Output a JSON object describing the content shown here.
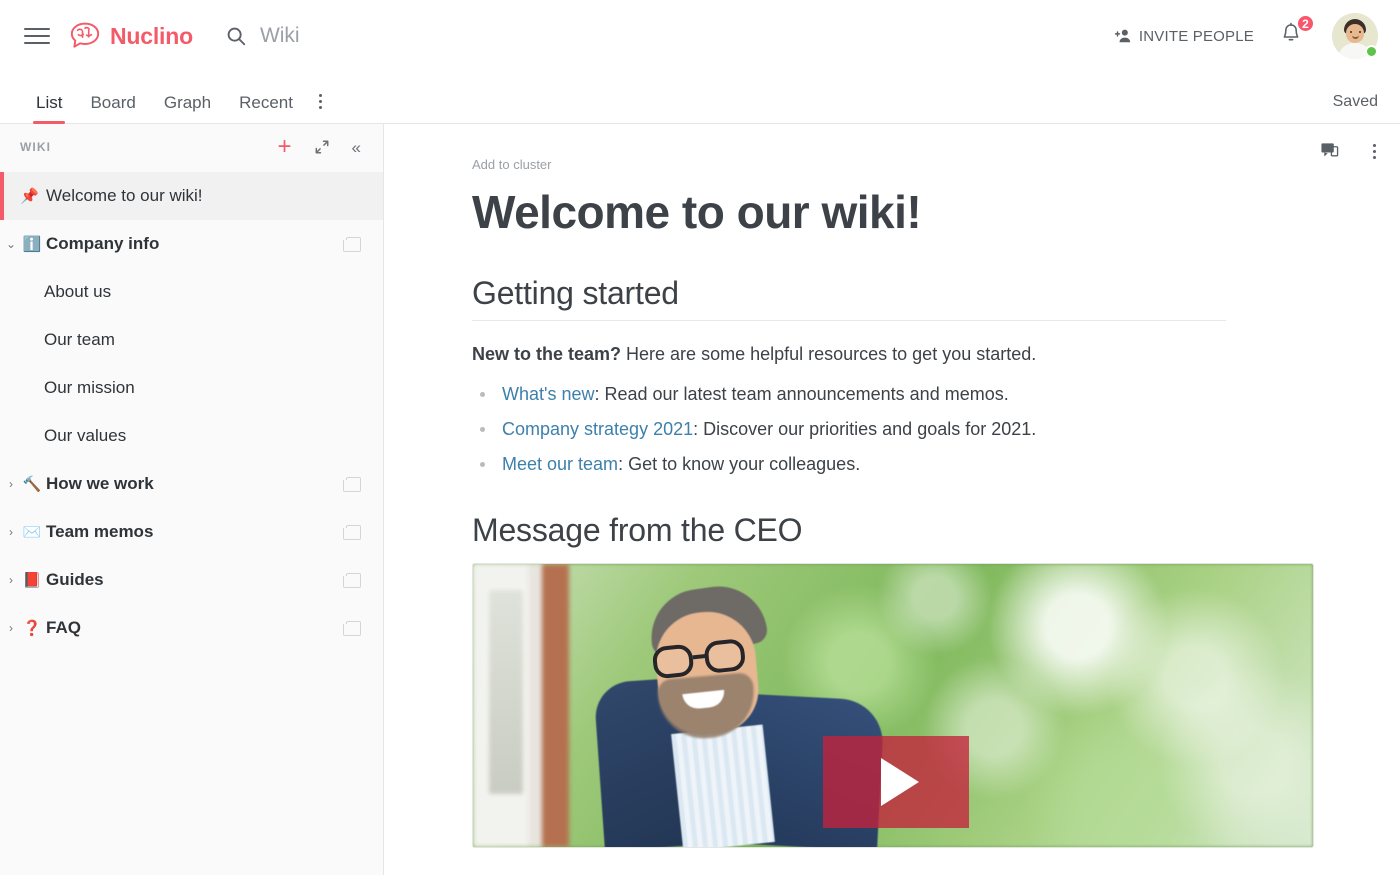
{
  "topbar": {
    "menu_icon": "hamburger-menu-icon",
    "brand": "Nuclino",
    "search_placeholder": "Wiki",
    "search_value": "Wiki",
    "invite_label": "INVITE PEOPLE",
    "notification_count": "2",
    "accent_color": "#f35b69",
    "badge_color": "#f7566b",
    "online_color": "#5cc44a"
  },
  "tabbar": {
    "tabs": [
      {
        "label": "List",
        "active": true
      },
      {
        "label": "Board",
        "active": false
      },
      {
        "label": "Graph",
        "active": false
      },
      {
        "label": "Recent",
        "active": false
      }
    ],
    "more_label": "more-options",
    "status": "Saved"
  },
  "sidebar": {
    "title": "WIKI",
    "actions": [
      {
        "name": "add-item-button",
        "label": "+"
      },
      {
        "name": "expand-sidebar-button",
        "label": "expand"
      },
      {
        "name": "collapse-sidebar-button",
        "label": "«"
      }
    ],
    "items": [
      {
        "label": "Welcome to our wiki!",
        "emoji": "📌",
        "type": "pinned",
        "selected": true,
        "caret": "",
        "cluster": false
      },
      {
        "label": "Company info",
        "emoji": "ℹ️",
        "type": "cluster",
        "selected": false,
        "caret": "⌄",
        "cluster": true
      },
      {
        "label": "About us",
        "emoji": "",
        "type": "child",
        "selected": false,
        "caret": "",
        "cluster": false
      },
      {
        "label": "Our team",
        "emoji": "",
        "type": "child",
        "selected": false,
        "caret": "",
        "cluster": false
      },
      {
        "label": "Our mission",
        "emoji": "",
        "type": "child",
        "selected": false,
        "caret": "",
        "cluster": false
      },
      {
        "label": "Our values",
        "emoji": "",
        "type": "child",
        "selected": false,
        "caret": "",
        "cluster": false
      },
      {
        "label": "How we work",
        "emoji": "🔨",
        "type": "cluster",
        "selected": false,
        "caret": "›",
        "cluster": true
      },
      {
        "label": "Team memos",
        "emoji": "✉️",
        "type": "cluster",
        "selected": false,
        "caret": "›",
        "cluster": true
      },
      {
        "label": "Guides",
        "emoji": "📕",
        "type": "cluster",
        "selected": false,
        "caret": "›",
        "cluster": true
      },
      {
        "label": "FAQ",
        "emoji": "❓",
        "type": "cluster",
        "selected": false,
        "caret": "›",
        "cluster": true
      }
    ]
  },
  "document": {
    "tools": [
      {
        "name": "comments-icon"
      },
      {
        "name": "document-menu-icon"
      }
    ],
    "add_to_cluster": "Add to cluster",
    "title": "Welcome to our wiki!",
    "sections": [
      {
        "heading": "Getting started",
        "intro_bold": "New to the team?",
        "intro_rest": " Here are some helpful resources to get you started.",
        "bullets": [
          {
            "link": "What's new",
            "rest": ": Read our latest team announcements and memos."
          },
          {
            "link": "Company strategy 2021",
            "rest": ": Discover our priorities and goals for 2021."
          },
          {
            "link": "Meet our team",
            "rest": ": Get to know your colleagues."
          }
        ]
      },
      {
        "heading": "Message from the CEO",
        "media": "video-thumbnail",
        "play_label": "play-video"
      }
    ],
    "link_color": "#3d80ab"
  }
}
